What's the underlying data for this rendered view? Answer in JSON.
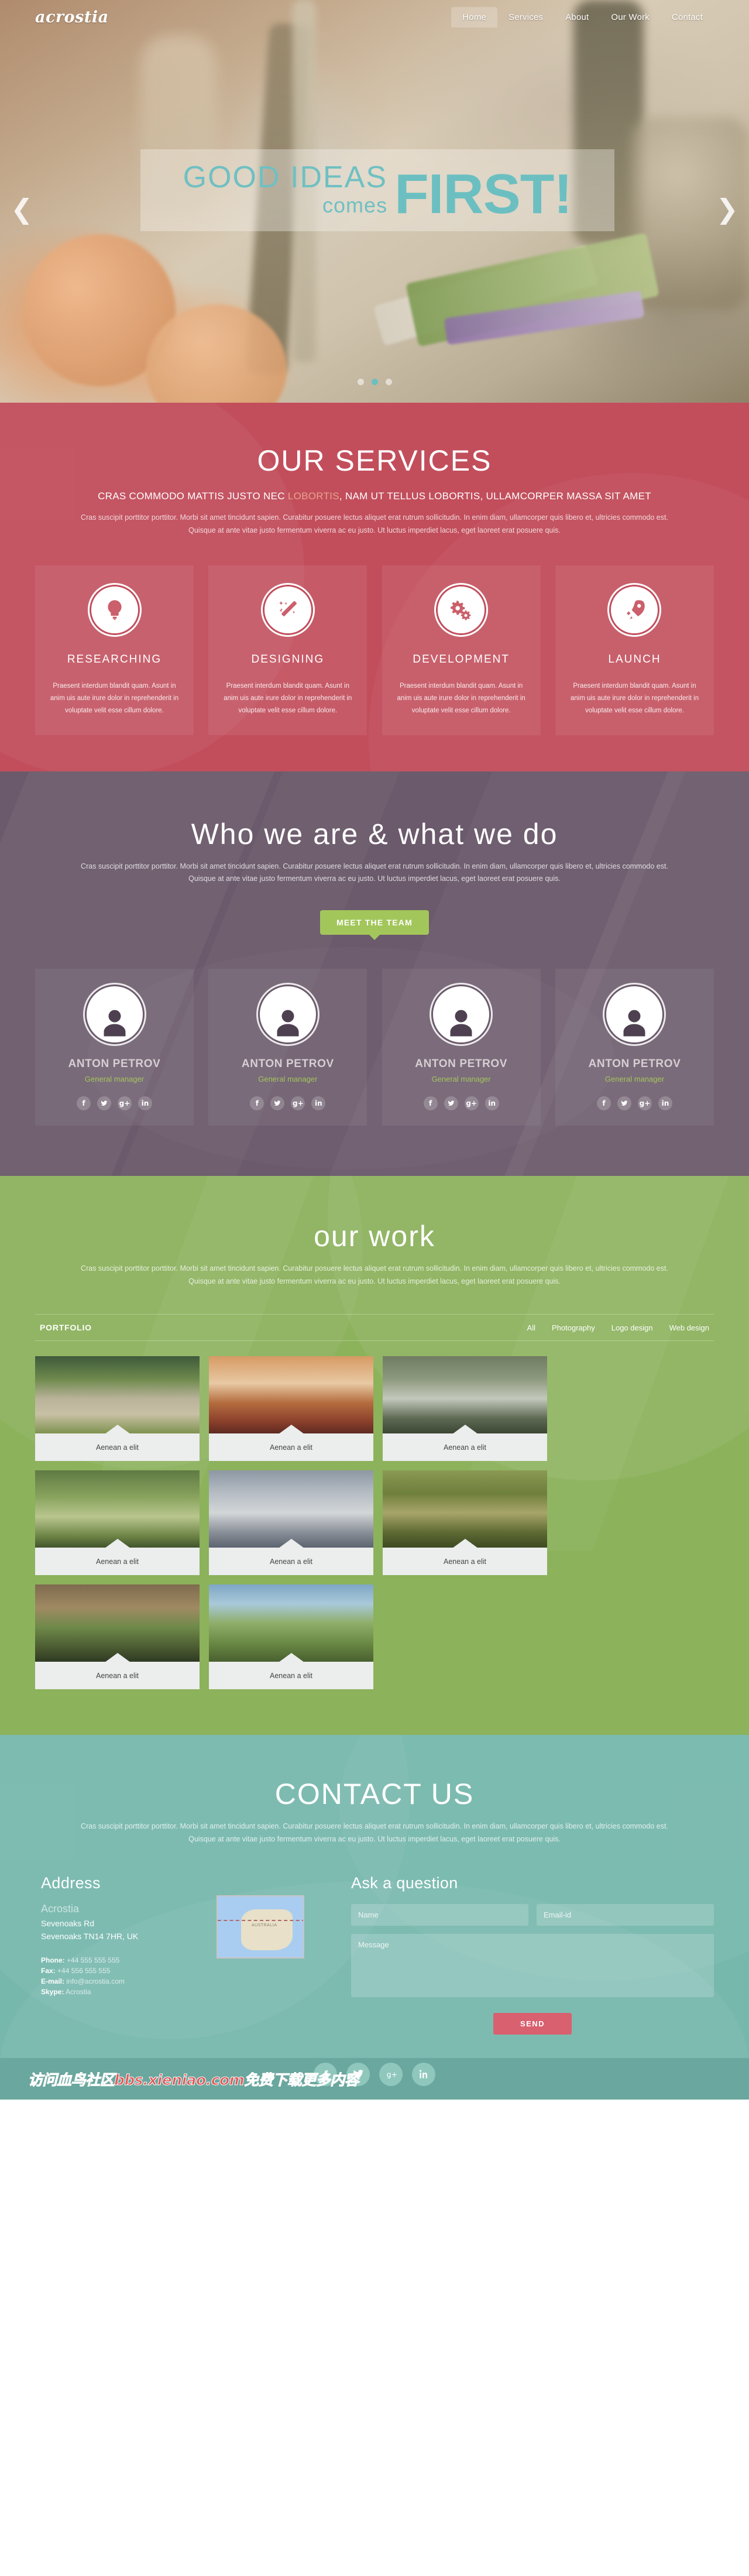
{
  "brand": {
    "logo": "acrostia"
  },
  "nav": {
    "items": [
      {
        "label": "Home",
        "active": true
      },
      {
        "label": "Services",
        "active": false
      },
      {
        "label": "About",
        "active": false
      },
      {
        "label": "Our Work",
        "active": false
      },
      {
        "label": "Contact",
        "active": false
      }
    ]
  },
  "hero": {
    "line1": "GOOD IDEAS",
    "line2": "comes",
    "big": "FIRST!",
    "prev_icon": "chevron-left-icon",
    "next_icon": "chevron-right-icon",
    "slides": 3,
    "active_slide": 2,
    "accent_color": "#6cbfc1"
  },
  "services": {
    "title": "OUR SERVICES",
    "subtitle_pre": "CRAS COMMODO MATTIS JUSTO NEC ",
    "subtitle_highlight": "LOBORTIS",
    "subtitle_post": ", NAM UT TELLUS LOBORTIS, ULLAMCORPER MASSA SIT AMET",
    "paragraph": "Cras suscipit porttitor porttitor. Morbi sit amet tincidunt sapien. Curabitur posuere lectus aliquet erat rutrum sollicitudin. In enim diam, ullamcorper quis libero et, ultricies commodo est. Quisque at ante vitae justo fermentum viverra ac eu justo. Ut luctus imperdiet lacus, eget laoreet erat posuere quis.",
    "accent_color": "#c24e5c",
    "items": [
      {
        "name": "RESEARCHING",
        "icon": "lightbulb-icon",
        "text": "Praesent interdum blandit quam. Asunt in anim uis aute irure dolor in reprehenderit in voluptate velit esse cillum dolore."
      },
      {
        "name": "DESIGNING",
        "icon": "magic-wand-icon",
        "text": "Praesent interdum blandit quam. Asunt in anim uis aute irure dolor in reprehenderit in voluptate velit esse cillum dolore."
      },
      {
        "name": "DEVELOPMENT",
        "icon": "gears-icon",
        "text": "Praesent interdum blandit quam. Asunt in anim uis aute irure dolor in reprehenderit in voluptate velit esse cillum dolore."
      },
      {
        "name": "LAUNCH",
        "icon": "rocket-icon",
        "text": "Praesent interdum blandit quam. Asunt in anim uis aute irure dolor in reprehenderit in voluptate velit esse cillum dolore."
      }
    ]
  },
  "team": {
    "title": "Who we are & what we do",
    "paragraph": "Cras suscipit porttitor porttitor. Morbi sit amet tincidunt sapien. Curabitur posuere lectus aliquet erat rutrum sollicitudin. In enim diam, ullamcorper quis libero et, ultricies commodo est. Quisque at ante vitae justo fermentum viverra ac eu justo. Ut luctus imperdiet lacus, eget laoreet erat posuere quis.",
    "button_label": "MEET THE TEAM",
    "button_color": "#a3c65b",
    "bg_color": "#6b5a6b",
    "members": [
      {
        "name": "ANTON PETROV",
        "role": "General manager"
      },
      {
        "name": "ANTON PETROV",
        "role": "General manager"
      },
      {
        "name": "ANTON PETROV",
        "role": "General manager"
      },
      {
        "name": "ANTON PETROV",
        "role": "General manager"
      }
    ],
    "social_icons": [
      "facebook-icon",
      "twitter-icon",
      "google-plus-icon",
      "linkedin-icon"
    ]
  },
  "work": {
    "title": "our work",
    "paragraph": "Cras suscipit porttitor porttitor. Morbi sit amet tincidunt sapien. Curabitur posuere lectus aliquet erat rutrum sollicitudin. In enim diam, ullamcorper quis libero et, ultricies commodo est. Quisque at ante vitae justo fermentum viverra ac eu justo. Ut luctus imperdiet lacus, eget laoreet erat posuere quis.",
    "portfolio_label": "PORTFOLIO",
    "bg_color": "#8cb25c",
    "filters": [
      {
        "label": "All",
        "active": true
      },
      {
        "label": "Photography",
        "active": false
      },
      {
        "label": "Logo design",
        "active": false
      },
      {
        "label": "Web design",
        "active": false
      }
    ],
    "items": [
      {
        "caption": "Aenean a elit",
        "thumb": "forest-trail-photo"
      },
      {
        "caption": "Aenean a elit",
        "thumb": "hedgehog-photo"
      },
      {
        "caption": "Aenean a elit",
        "thumb": "waterfall-rocks-photo"
      },
      {
        "caption": "Aenean a elit",
        "thumb": "green-path-photo"
      },
      {
        "caption": "Aenean a elit",
        "thumb": "mountain-range-photo"
      },
      {
        "caption": "Aenean a elit",
        "thumb": "mossy-rock-photo"
      },
      {
        "caption": "Aenean a elit",
        "thumb": "leaf-on-rock-photo"
      },
      {
        "caption": "Aenean a elit",
        "thumb": "forest-road-photo"
      }
    ]
  },
  "contact": {
    "title": "CONTACT US",
    "paragraph": "Cras suscipit porttitor porttitor. Morbi sit amet tincidunt sapien. Curabitur posuere lectus aliquet erat rutrum sollicitudin. In enim diam, ullamcorper quis libero et, ultricies commodo est. Quisque at ante vitae justo fermentum viverra ac eu justo. Ut luctus imperdiet lacus, eget laoreet erat posuere quis.",
    "bg_color": "#77b8ad",
    "address": {
      "heading": "Address",
      "company": "Acrostia",
      "line1": "Sevenoaks Rd",
      "line2": "Sevenoaks TN14 7HR, UK",
      "phone_label": "Phone:",
      "phone_value": "+44 555 555 555",
      "fax_label": "Fax:",
      "fax_value": "+44 556 555 555",
      "email_label": "E-mail:",
      "email_value": "info@acrostia.com",
      "skype_label": "Skype:",
      "skype_value": "Acrostia",
      "map_label": "AUSTRALIA"
    },
    "form": {
      "heading": "Ask a question",
      "name_placeholder": "Name",
      "email_placeholder": "Email-id",
      "message_placeholder": "Message",
      "submit_label": "SEND",
      "submit_color": "#d9606f"
    }
  },
  "footer": {
    "bg_color": "#6aa79e",
    "social_icons": [
      "facebook-icon",
      "twitter-icon",
      "google-plus-icon",
      "linkedin-icon"
    ],
    "watermark": "访问血鸟社区bbs.xieniao.com免费下载更多内容"
  }
}
